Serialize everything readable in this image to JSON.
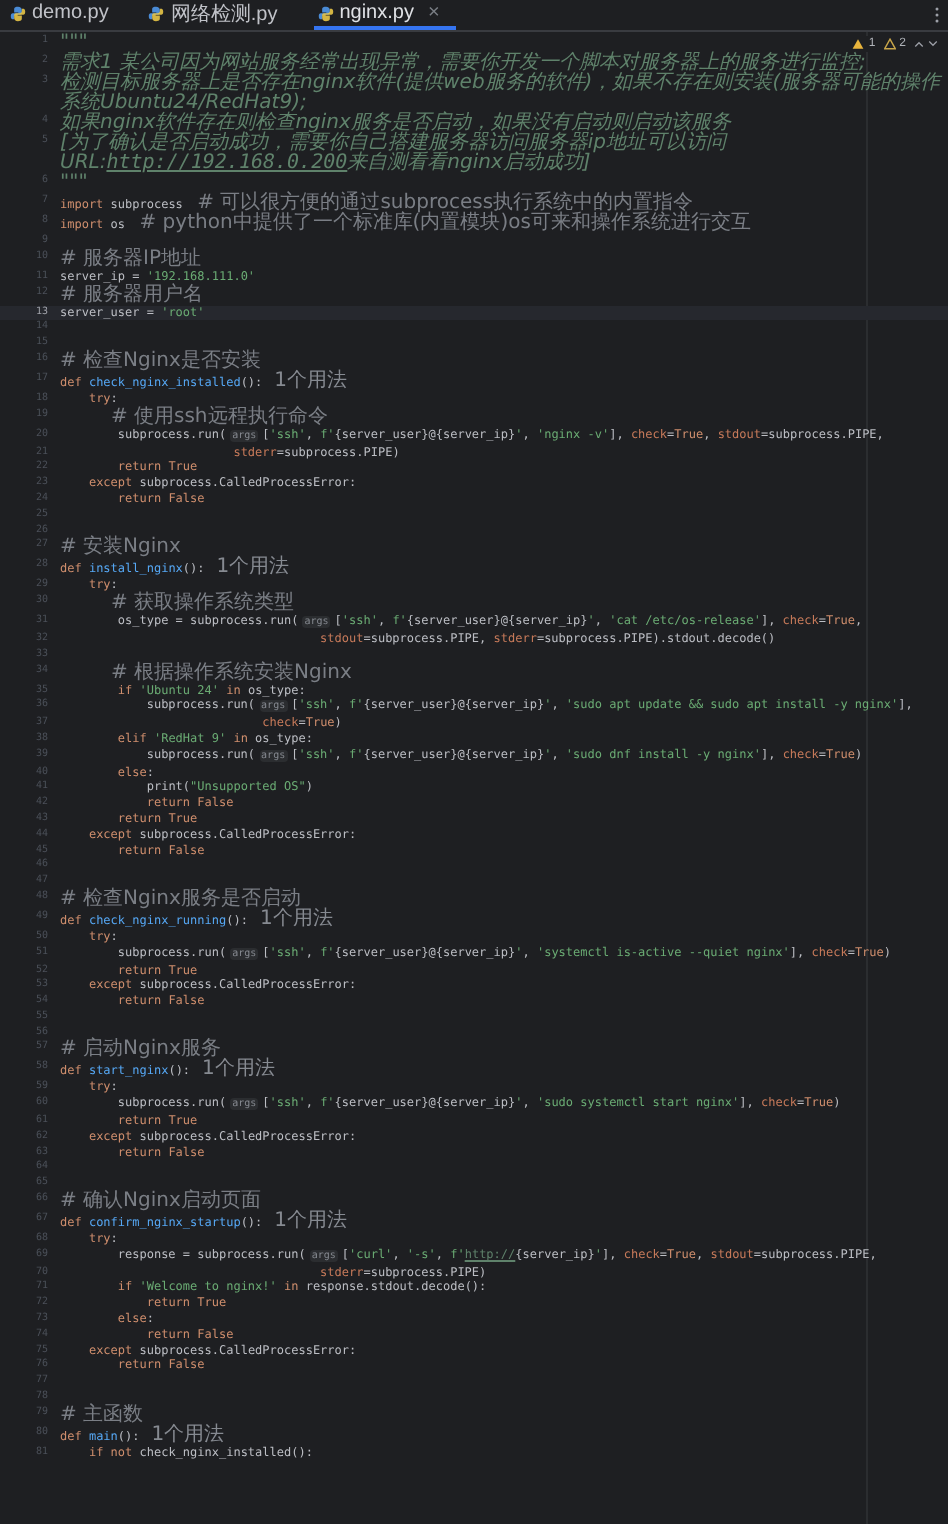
{
  "tabs": [
    {
      "label": "demo.py",
      "selected": false
    },
    {
      "label": "网络检测.py",
      "selected": false
    },
    {
      "label": "nginx.py",
      "selected": true,
      "close": "×"
    }
  ],
  "inspections": {
    "warnings": "1",
    "weak_warnings": "2"
  },
  "lines": [
    {
      "number": "1",
      "current": false,
      "segments": [
        {
          "kind": "code",
          "tokens": [
            {
              "kind": "docstring",
              "text": "\"\"\""
            }
          ]
        }
      ]
    },
    {
      "number": "2",
      "current": false,
      "segments": [
        {
          "kind": "code",
          "tokens": [
            {
              "kind": "docstring",
              "text": "需求1 某公司因为网站服务经常出现异常，需要你开发一个脚本对服务器上的服务进行监控;"
            }
          ]
        }
      ]
    },
    {
      "number": "3",
      "current": false,
      "segments": [
        {
          "kind": "code",
          "tokens": [
            {
              "kind": "docstring",
              "text": "检测目标服务器上是否存在nginx软件(提供web服务的软件)，如果不存在则安装(服务器可能的操作系统Ubuntu24/RedHat9);"
            }
          ]
        }
      ]
    },
    {
      "number": "4",
      "current": false,
      "segments": [
        {
          "kind": "code",
          "tokens": [
            {
              "kind": "docstring",
              "text": "如果nginx软件存在则检查nginx服务是否启动，如果没有启动则启动该服务"
            }
          ]
        }
      ]
    },
    {
      "number": "5",
      "current": false,
      "segments": [
        {
          "kind": "code",
          "tokens": [
            {
              "kind": "docstring",
              "text": "[为了确认是否启动成功，需要你自己搭建服务器访问服务器ip地址可以访问URL:"
            },
            {
              "kind": "url",
              "text": "http://192.168.0.200"
            },
            {
              "kind": "docstring",
              "text": "来自测看看nginx启动成功]"
            }
          ]
        }
      ]
    },
    {
      "number": "6",
      "current": false,
      "segments": [
        {
          "kind": "code",
          "tokens": [
            {
              "kind": "docstring",
              "text": "\"\"\""
            }
          ]
        }
      ]
    },
    {
      "number": "7",
      "current": false,
      "segments": [
        {
          "kind": "code",
          "tokens": [
            {
              "kind": "keyword",
              "text": "import"
            },
            {
              "kind": "plain",
              "text": " subprocess  "
            },
            {
              "kind": "comment",
              "text": "# 可以很方便的通过subprocess执行系统中的内置指令"
            }
          ]
        }
      ]
    },
    {
      "number": "8",
      "current": false,
      "segments": [
        {
          "kind": "code",
          "tokens": [
            {
              "kind": "keyword",
              "text": "import"
            },
            {
              "kind": "plain",
              "text": " os  "
            },
            {
              "kind": "comment",
              "text": "# python中提供了一个标准库(内置模块)os可来和操作系统进行交互"
            }
          ]
        }
      ]
    },
    {
      "number": "9",
      "current": false
    },
    {
      "number": "10",
      "current": false,
      "segments": [
        {
          "kind": "code",
          "tokens": [
            {
              "kind": "comment",
              "text": "# 服务器IP地址"
            }
          ]
        }
      ]
    },
    {
      "number": "11",
      "current": false,
      "segments": [
        {
          "kind": "code",
          "tokens": [
            {
              "kind": "plain",
              "text": "server_ip = "
            },
            {
              "kind": "string",
              "text": "'192.168.111.0'"
            }
          ]
        }
      ]
    },
    {
      "number": "12",
      "current": false,
      "segments": [
        {
          "kind": "code",
          "tokens": [
            {
              "kind": "comment",
              "text": "# 服务器用户名"
            }
          ]
        }
      ]
    },
    {
      "number": "13",
      "current": true,
      "segments": [
        {
          "kind": "code",
          "tokens": [
            {
              "kind": "plain",
              "text": "server_user = "
            },
            {
              "kind": "string",
              "text": "'root'"
            }
          ]
        }
      ]
    },
    {
      "number": "14",
      "current": false
    },
    {
      "number": "15",
      "current": false
    },
    {
      "number": "16",
      "current": false,
      "segments": [
        {
          "kind": "code",
          "tokens": [
            {
              "kind": "comment",
              "text": "# 检查Nginx是否安装"
            }
          ]
        }
      ]
    },
    {
      "number": "17",
      "current": false,
      "segments": [
        {
          "kind": "code",
          "tokens": [
            {
              "kind": "keyword",
              "text": "def "
            },
            {
              "kind": "function",
              "text": "check_nginx_installed"
            },
            {
              "kind": "plain",
              "text": "():"
            }
          ]
        },
        {
          "kind": "usage",
          "text": "1个用法"
        }
      ]
    },
    {
      "number": "18",
      "current": false,
      "segments": [
        {
          "kind": "code",
          "tokens": [
            {
              "kind": "keyword",
              "text": "    try"
            },
            {
              "kind": "plain",
              "text": ":"
            }
          ]
        }
      ]
    },
    {
      "number": "19",
      "current": false,
      "segments": [
        {
          "kind": "code",
          "tokens": [
            {
              "kind": "comment",
              "text": "        # 使用ssh远程执行命令"
            }
          ]
        }
      ]
    },
    {
      "number": "20",
      "current": false,
      "segments": [
        {
          "kind": "code",
          "tokens": [
            {
              "kind": "plain",
              "text": "        subprocess.run("
            }
          ]
        },
        {
          "kind": "hint",
          "text": "args"
        },
        {
          "kind": "code",
          "tokens": [
            {
              "kind": "plain",
              "text": "["
            },
            {
              "kind": "string",
              "text": "'ssh'"
            },
            {
              "kind": "plain",
              "text": ", "
            },
            {
              "kind": "string",
              "text": "f'"
            },
            {
              "kind": "plain",
              "text": "{server_user}@{server_ip}"
            },
            {
              "kind": "string",
              "text": "'"
            },
            {
              "kind": "plain",
              "text": ", "
            },
            {
              "kind": "string",
              "text": "'nginx -v'"
            },
            {
              "kind": "plain",
              "text": "], "
            },
            {
              "kind": "named_arg",
              "text": "check"
            },
            {
              "kind": "plain",
              "text": "="
            },
            {
              "kind": "keyword",
              "text": "True"
            },
            {
              "kind": "plain",
              "text": ", "
            },
            {
              "kind": "named_arg",
              "text": "stdout"
            },
            {
              "kind": "plain",
              "text": "=subprocess.PIPE,"
            }
          ]
        }
      ]
    },
    {
      "number": "21",
      "current": false,
      "segments": [
        {
          "kind": "code",
          "tokens": [
            {
              "kind": "named_arg",
              "text": "                        stderr"
            },
            {
              "kind": "plain",
              "text": "=subprocess.PIPE)"
            }
          ]
        }
      ]
    },
    {
      "number": "22",
      "current": false,
      "segments": [
        {
          "kind": "code",
          "tokens": [
            {
              "kind": "keyword",
              "text": "        return True"
            }
          ]
        }
      ]
    },
    {
      "number": "23",
      "current": false,
      "segments": [
        {
          "kind": "code",
          "tokens": [
            {
              "kind": "keyword",
              "text": "    except"
            },
            {
              "kind": "plain",
              "text": " subprocess.CalledProcessError:"
            }
          ]
        }
      ]
    },
    {
      "number": "24",
      "current": false,
      "segments": [
        {
          "kind": "code",
          "tokens": [
            {
              "kind": "keyword",
              "text": "        return False"
            }
          ]
        }
      ]
    },
    {
      "number": "25",
      "current": false
    },
    {
      "number": "26",
      "current": false
    },
    {
      "number": "27",
      "current": false,
      "segments": [
        {
          "kind": "code",
          "tokens": [
            {
              "kind": "comment",
              "text": "# 安装Nginx"
            }
          ]
        }
      ]
    },
    {
      "number": "28",
      "current": false,
      "segments": [
        {
          "kind": "code",
          "tokens": [
            {
              "kind": "keyword",
              "text": "def "
            },
            {
              "kind": "function",
              "text": "install_nginx"
            },
            {
              "kind": "plain",
              "text": "():"
            }
          ]
        },
        {
          "kind": "usage",
          "text": "1个用法"
        }
      ]
    },
    {
      "number": "29",
      "current": false,
      "segments": [
        {
          "kind": "code",
          "tokens": [
            {
              "kind": "keyword",
              "text": "    try"
            },
            {
              "kind": "plain",
              "text": ":"
            }
          ]
        }
      ]
    },
    {
      "number": "30",
      "current": false,
      "segments": [
        {
          "kind": "code",
          "tokens": [
            {
              "kind": "comment",
              "text": "        # 获取操作系统类型"
            }
          ]
        }
      ]
    },
    {
      "number": "31",
      "current": false,
      "segments": [
        {
          "kind": "code",
          "tokens": [
            {
              "kind": "plain",
              "text": "        os_type = subprocess.run("
            }
          ]
        },
        {
          "kind": "hint",
          "text": "args"
        },
        {
          "kind": "code",
          "tokens": [
            {
              "kind": "plain",
              "text": "["
            },
            {
              "kind": "string",
              "text": "'ssh'"
            },
            {
              "kind": "plain",
              "text": ", "
            },
            {
              "kind": "string",
              "text": "f'"
            },
            {
              "kind": "plain",
              "text": "{server_user}@{server_ip}"
            },
            {
              "kind": "string",
              "text": "'"
            },
            {
              "kind": "plain",
              "text": ", "
            },
            {
              "kind": "string",
              "text": "'cat /etc/os-release'"
            },
            {
              "kind": "plain",
              "text": "], "
            },
            {
              "kind": "named_arg",
              "text": "check"
            },
            {
              "kind": "plain",
              "text": "="
            },
            {
              "kind": "keyword",
              "text": "True"
            },
            {
              "kind": "plain",
              "text": ","
            }
          ]
        }
      ]
    },
    {
      "number": "32",
      "current": false,
      "segments": [
        {
          "kind": "code",
          "tokens": [
            {
              "kind": "named_arg",
              "text": "                                    stdout"
            },
            {
              "kind": "plain",
              "text": "=subprocess.PIPE, "
            },
            {
              "kind": "named_arg",
              "text": "stderr"
            },
            {
              "kind": "plain",
              "text": "=subprocess.PIPE).stdout.decode()"
            }
          ]
        }
      ]
    },
    {
      "number": "33",
      "current": false
    },
    {
      "number": "34",
      "current": false,
      "segments": [
        {
          "kind": "code",
          "tokens": [
            {
              "kind": "comment",
              "text": "        # 根据操作系统安装Nginx"
            }
          ]
        }
      ]
    },
    {
      "number": "35",
      "current": false,
      "segments": [
        {
          "kind": "code",
          "tokens": [
            {
              "kind": "keyword",
              "text": "        if "
            },
            {
              "kind": "string",
              "text": "'Ubuntu 24'"
            },
            {
              "kind": "keyword",
              "text": " in"
            },
            {
              "kind": "plain",
              "text": " os_type:"
            }
          ]
        }
      ]
    },
    {
      "number": "36",
      "current": false,
      "segments": [
        {
          "kind": "code",
          "tokens": [
            {
              "kind": "plain",
              "text": "            subprocess.run("
            }
          ]
        },
        {
          "kind": "hint",
          "text": "args"
        },
        {
          "kind": "code",
          "tokens": [
            {
              "kind": "plain",
              "text": "["
            },
            {
              "kind": "string",
              "text": "'ssh'"
            },
            {
              "kind": "plain",
              "text": ", "
            },
            {
              "kind": "string",
              "text": "f'"
            },
            {
              "kind": "plain",
              "text": "{server_user}@{server_ip}"
            },
            {
              "kind": "string",
              "text": "'"
            },
            {
              "kind": "plain",
              "text": ", "
            },
            {
              "kind": "string",
              "text": "'sudo apt update && sudo apt install -y nginx'"
            },
            {
              "kind": "plain",
              "text": "],"
            }
          ]
        }
      ]
    },
    {
      "number": "37",
      "current": false,
      "segments": [
        {
          "kind": "code",
          "tokens": [
            {
              "kind": "named_arg",
              "text": "                            check"
            },
            {
              "kind": "plain",
              "text": "="
            },
            {
              "kind": "keyword",
              "text": "True"
            },
            {
              "kind": "plain",
              "text": ")"
            }
          ]
        }
      ]
    },
    {
      "number": "38",
      "current": false,
      "segments": [
        {
          "kind": "code",
          "tokens": [
            {
              "kind": "keyword",
              "text": "        elif "
            },
            {
              "kind": "string",
              "text": "'RedHat 9'"
            },
            {
              "kind": "keyword",
              "text": " in"
            },
            {
              "kind": "plain",
              "text": " os_type:"
            }
          ]
        }
      ]
    },
    {
      "number": "39",
      "current": false,
      "segments": [
        {
          "kind": "code",
          "tokens": [
            {
              "kind": "plain",
              "text": "            subprocess.run("
            }
          ]
        },
        {
          "kind": "hint",
          "text": "args"
        },
        {
          "kind": "code",
          "tokens": [
            {
              "kind": "plain",
              "text": "["
            },
            {
              "kind": "string",
              "text": "'ssh'"
            },
            {
              "kind": "plain",
              "text": ", "
            },
            {
              "kind": "string",
              "text": "f'"
            },
            {
              "kind": "plain",
              "text": "{server_user}@{server_ip}"
            },
            {
              "kind": "string",
              "text": "'"
            },
            {
              "kind": "plain",
              "text": ", "
            },
            {
              "kind": "string",
              "text": "'sudo dnf install -y nginx'"
            },
            {
              "kind": "plain",
              "text": "], "
            },
            {
              "kind": "named_arg",
              "text": "check"
            },
            {
              "kind": "plain",
              "text": "="
            },
            {
              "kind": "keyword",
              "text": "True"
            },
            {
              "kind": "plain",
              "text": ")"
            }
          ]
        }
      ]
    },
    {
      "number": "40",
      "current": false,
      "segments": [
        {
          "kind": "code",
          "tokens": [
            {
              "kind": "keyword",
              "text": "        else"
            },
            {
              "kind": "plain",
              "text": ":"
            }
          ]
        }
      ]
    },
    {
      "number": "41",
      "current": false,
      "segments": [
        {
          "kind": "code",
          "tokens": [
            {
              "kind": "plain",
              "text": "            print("
            },
            {
              "kind": "string",
              "text": "\"Unsupported OS\""
            },
            {
              "kind": "plain",
              "text": ")"
            }
          ]
        }
      ]
    },
    {
      "number": "42",
      "current": false,
      "segments": [
        {
          "kind": "code",
          "tokens": [
            {
              "kind": "keyword",
              "text": "            return False"
            }
          ]
        }
      ]
    },
    {
      "number": "43",
      "current": false,
      "segments": [
        {
          "kind": "code",
          "tokens": [
            {
              "kind": "keyword",
              "text": "        return True"
            }
          ]
        }
      ]
    },
    {
      "number": "44",
      "current": false,
      "segments": [
        {
          "kind": "code",
          "tokens": [
            {
              "kind": "keyword",
              "text": "    except"
            },
            {
              "kind": "plain",
              "text": " subprocess.CalledProcessError:"
            }
          ]
        }
      ]
    },
    {
      "number": "45",
      "current": false,
      "segments": [
        {
          "kind": "code",
          "tokens": [
            {
              "kind": "keyword",
              "text": "        return False"
            }
          ]
        }
      ]
    },
    {
      "number": "46",
      "current": false
    },
    {
      "number": "47",
      "current": false
    },
    {
      "number": "48",
      "current": false,
      "segments": [
        {
          "kind": "code",
          "tokens": [
            {
              "kind": "comment",
              "text": "# 检查Nginx服务是否启动"
            }
          ]
        }
      ]
    },
    {
      "number": "49",
      "current": false,
      "segments": [
        {
          "kind": "code",
          "tokens": [
            {
              "kind": "keyword",
              "text": "def "
            },
            {
              "kind": "function",
              "text": "check_nginx_running"
            },
            {
              "kind": "plain",
              "text": "():"
            }
          ]
        },
        {
          "kind": "usage",
          "text": "1个用法"
        }
      ]
    },
    {
      "number": "50",
      "current": false,
      "segments": [
        {
          "kind": "code",
          "tokens": [
            {
              "kind": "keyword",
              "text": "    try"
            },
            {
              "kind": "plain",
              "text": ":"
            }
          ]
        }
      ]
    },
    {
      "number": "51",
      "current": false,
      "segments": [
        {
          "kind": "code",
          "tokens": [
            {
              "kind": "plain",
              "text": "        subprocess.run("
            }
          ]
        },
        {
          "kind": "hint",
          "text": "args"
        },
        {
          "kind": "code",
          "tokens": [
            {
              "kind": "plain",
              "text": "["
            },
            {
              "kind": "string",
              "text": "'ssh'"
            },
            {
              "kind": "plain",
              "text": ", "
            },
            {
              "kind": "string",
              "text": "f'"
            },
            {
              "kind": "plain",
              "text": "{server_user}@{server_ip}"
            },
            {
              "kind": "string",
              "text": "'"
            },
            {
              "kind": "plain",
              "text": ", "
            },
            {
              "kind": "string",
              "text": "'systemctl is-active --quiet nginx'"
            },
            {
              "kind": "plain",
              "text": "], "
            },
            {
              "kind": "named_arg",
              "text": "check"
            },
            {
              "kind": "plain",
              "text": "="
            },
            {
              "kind": "keyword",
              "text": "True"
            },
            {
              "kind": "plain",
              "text": ")"
            }
          ]
        }
      ]
    },
    {
      "number": "52",
      "current": false,
      "segments": [
        {
          "kind": "code",
          "tokens": [
            {
              "kind": "keyword",
              "text": "        return True"
            }
          ]
        }
      ]
    },
    {
      "number": "53",
      "current": false,
      "segments": [
        {
          "kind": "code",
          "tokens": [
            {
              "kind": "keyword",
              "text": "    except"
            },
            {
              "kind": "plain",
              "text": " subprocess.CalledProcessError:"
            }
          ]
        }
      ]
    },
    {
      "number": "54",
      "current": false,
      "segments": [
        {
          "kind": "code",
          "tokens": [
            {
              "kind": "keyword",
              "text": "        return False"
            }
          ]
        }
      ]
    },
    {
      "number": "55",
      "current": false
    },
    {
      "number": "56",
      "current": false
    },
    {
      "number": "57",
      "current": false,
      "segments": [
        {
          "kind": "code",
          "tokens": [
            {
              "kind": "comment",
              "text": "# 启动Nginx服务"
            }
          ]
        }
      ]
    },
    {
      "number": "58",
      "current": false,
      "segments": [
        {
          "kind": "code",
          "tokens": [
            {
              "kind": "keyword",
              "text": "def "
            },
            {
              "kind": "function",
              "text": "start_nginx"
            },
            {
              "kind": "plain",
              "text": "():"
            }
          ]
        },
        {
          "kind": "usage",
          "text": "1个用法"
        }
      ]
    },
    {
      "number": "59",
      "current": false,
      "segments": [
        {
          "kind": "code",
          "tokens": [
            {
              "kind": "keyword",
              "text": "    try"
            },
            {
              "kind": "plain",
              "text": ":"
            }
          ]
        }
      ]
    },
    {
      "number": "60",
      "current": false,
      "segments": [
        {
          "kind": "code",
          "tokens": [
            {
              "kind": "plain",
              "text": "        subprocess.run("
            }
          ]
        },
        {
          "kind": "hint",
          "text": "args"
        },
        {
          "kind": "code",
          "tokens": [
            {
              "kind": "plain",
              "text": "["
            },
            {
              "kind": "string",
              "text": "'ssh'"
            },
            {
              "kind": "plain",
              "text": ", "
            },
            {
              "kind": "string",
              "text": "f'"
            },
            {
              "kind": "plain",
              "text": "{server_user}@{server_ip}"
            },
            {
              "kind": "string",
              "text": "'"
            },
            {
              "kind": "plain",
              "text": ", "
            },
            {
              "kind": "string",
              "text": "'sudo systemctl start nginx'"
            },
            {
              "kind": "plain",
              "text": "], "
            },
            {
              "kind": "named_arg",
              "text": "check"
            },
            {
              "kind": "plain",
              "text": "="
            },
            {
              "kind": "keyword",
              "text": "True"
            },
            {
              "kind": "plain",
              "text": ")"
            }
          ]
        }
      ]
    },
    {
      "number": "61",
      "current": false,
      "segments": [
        {
          "kind": "code",
          "tokens": [
            {
              "kind": "keyword",
              "text": "        return True"
            }
          ]
        }
      ]
    },
    {
      "number": "62",
      "current": false,
      "segments": [
        {
          "kind": "code",
          "tokens": [
            {
              "kind": "keyword",
              "text": "    except"
            },
            {
              "kind": "plain",
              "text": " subprocess.CalledProcessError:"
            }
          ]
        }
      ]
    },
    {
      "number": "63",
      "current": false,
      "segments": [
        {
          "kind": "code",
          "tokens": [
            {
              "kind": "keyword",
              "text": "        return False"
            }
          ]
        }
      ]
    },
    {
      "number": "64",
      "current": false
    },
    {
      "number": "65",
      "current": false
    },
    {
      "number": "66",
      "current": false,
      "segments": [
        {
          "kind": "code",
          "tokens": [
            {
              "kind": "comment",
              "text": "# 确认Nginx启动页面"
            }
          ]
        }
      ]
    },
    {
      "number": "67",
      "current": false,
      "segments": [
        {
          "kind": "code",
          "tokens": [
            {
              "kind": "keyword",
              "text": "def "
            },
            {
              "kind": "function",
              "text": "confirm_nginx_startup"
            },
            {
              "kind": "plain",
              "text": "():"
            }
          ]
        },
        {
          "kind": "usage",
          "text": "1个用法"
        }
      ]
    },
    {
      "number": "68",
      "current": false,
      "segments": [
        {
          "kind": "code",
          "tokens": [
            {
              "kind": "keyword",
              "text": "    try"
            },
            {
              "kind": "plain",
              "text": ":"
            }
          ]
        }
      ]
    },
    {
      "number": "69",
      "current": false,
      "segments": [
        {
          "kind": "code",
          "tokens": [
            {
              "kind": "plain",
              "text": "        response = subprocess.run("
            }
          ]
        },
        {
          "kind": "hint",
          "text": "args"
        },
        {
          "kind": "code",
          "tokens": [
            {
              "kind": "plain",
              "text": "["
            },
            {
              "kind": "string",
              "text": "'curl'"
            },
            {
              "kind": "plain",
              "text": ", "
            },
            {
              "kind": "string",
              "text": "'-s'"
            },
            {
              "kind": "plain",
              "text": ", "
            },
            {
              "kind": "string",
              "text": "f'"
            },
            {
              "kind": "url",
              "text": "http://"
            },
            {
              "kind": "plain",
              "text": "{server_ip}"
            },
            {
              "kind": "string",
              "text": "'"
            },
            {
              "kind": "plain",
              "text": "], "
            },
            {
              "kind": "named_arg",
              "text": "check"
            },
            {
              "kind": "plain",
              "text": "="
            },
            {
              "kind": "keyword",
              "text": "True"
            },
            {
              "kind": "plain",
              "text": ", "
            },
            {
              "kind": "named_arg",
              "text": "stdout"
            },
            {
              "kind": "plain",
              "text": "=subprocess.PIPE,"
            }
          ]
        }
      ]
    },
    {
      "number": "70",
      "current": false,
      "segments": [
        {
          "kind": "code",
          "tokens": [
            {
              "kind": "named_arg",
              "text": "                                    stderr"
            },
            {
              "kind": "plain",
              "text": "=subprocess.PIPE)"
            }
          ]
        }
      ]
    },
    {
      "number": "71",
      "current": false,
      "segments": [
        {
          "kind": "code",
          "tokens": [
            {
              "kind": "keyword",
              "text": "        if "
            },
            {
              "kind": "string",
              "text": "'Welcome to nginx!'"
            },
            {
              "kind": "keyword",
              "text": " in"
            },
            {
              "kind": "plain",
              "text": " response.stdout.decode():"
            }
          ]
        }
      ]
    },
    {
      "number": "72",
      "current": false,
      "segments": [
        {
          "kind": "code",
          "tokens": [
            {
              "kind": "keyword",
              "text": "            return True"
            }
          ]
        }
      ]
    },
    {
      "number": "73",
      "current": false,
      "segments": [
        {
          "kind": "code",
          "tokens": [
            {
              "kind": "keyword",
              "text": "        else"
            },
            {
              "kind": "plain",
              "text": ":"
            }
          ]
        }
      ]
    },
    {
      "number": "74",
      "current": false,
      "segments": [
        {
          "kind": "code",
          "tokens": [
            {
              "kind": "keyword",
              "text": "            return False"
            }
          ]
        }
      ]
    },
    {
      "number": "75",
      "current": false,
      "segments": [
        {
          "kind": "code",
          "tokens": [
            {
              "kind": "keyword",
              "text": "    except"
            },
            {
              "kind": "plain",
              "text": " subprocess.CalledProcessError:"
            }
          ]
        }
      ]
    },
    {
      "number": "76",
      "current": false,
      "segments": [
        {
          "kind": "code",
          "tokens": [
            {
              "kind": "keyword",
              "text": "        return False"
            }
          ]
        }
      ]
    },
    {
      "number": "77",
      "current": false
    },
    {
      "number": "78",
      "current": false
    },
    {
      "number": "79",
      "current": false,
      "segments": [
        {
          "kind": "code",
          "tokens": [
            {
              "kind": "comment",
              "text": "# 主函数"
            }
          ]
        }
      ]
    },
    {
      "number": "80",
      "current": false,
      "segments": [
        {
          "kind": "code",
          "tokens": [
            {
              "kind": "keyword",
              "text": "def "
            },
            {
              "kind": "function",
              "text": "main"
            },
            {
              "kind": "plain",
              "text": "():"
            }
          ]
        },
        {
          "kind": "usage",
          "text": "1个用法"
        }
      ]
    },
    {
      "number": "81",
      "current": false,
      "segments": [
        {
          "kind": "code",
          "tokens": [
            {
              "kind": "keyword",
              "text": "    if not "
            },
            {
              "kind": "plain",
              "text": "check_nginx_installed():"
            }
          ]
        }
      ]
    }
  ]
}
